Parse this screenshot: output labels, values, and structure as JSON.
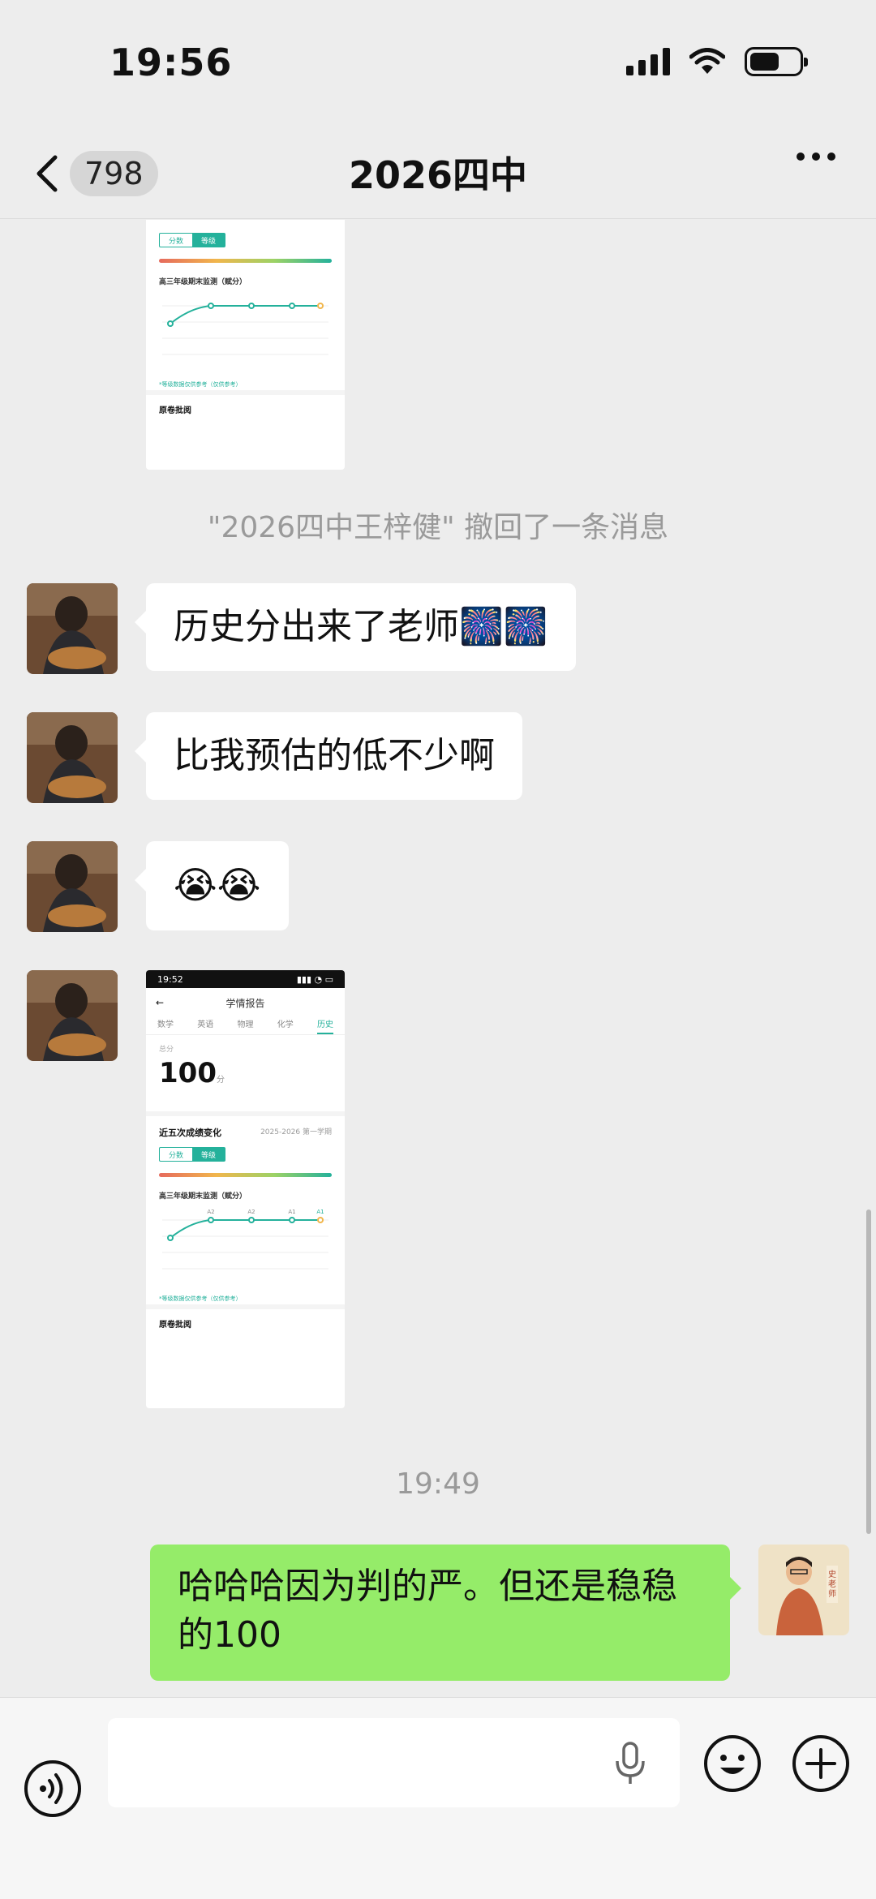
{
  "status_bar": {
    "time": "19:56",
    "signal_icon": "cellular-signal-icon",
    "wifi_icon": "wifi-icon",
    "battery_icon": "battery-icon",
    "battery_level": 0.6
  },
  "nav": {
    "unread_count": "798",
    "title": "2026四中",
    "back_icon": "chevron-left-icon",
    "more_icon": "more-dots-icon"
  },
  "chat": {
    "recall_notice": "\"2026四中王梓健\" 撤回了一条消息",
    "messages": [
      {
        "text": "历史分出来了老师🎆🎆"
      },
      {
        "text": "比我预估的低不少啊"
      },
      {
        "text": "😭😭"
      }
    ],
    "time_separator": "19:49",
    "my_message": "哈哈哈因为判的严。但还是稳稳的100",
    "screenshot": {
      "phone_time": "19:52",
      "header_title": "学情报告",
      "subjects": [
        "数学",
        "英语",
        "物理",
        "化学",
        "历史"
      ],
      "score_label": "总分",
      "score": "100",
      "score_unit": "分",
      "trend_title": "近五次成绩变化",
      "trend_filter": "2025-2026 第一学期",
      "toggle": [
        "分数",
        "等级"
      ],
      "exam_title": "高三年级期末监测（赋分）",
      "chart_points": [
        "A2",
        "A2",
        "A1",
        "A1"
      ],
      "chart_note": "*等级数据仅供参考（仅供参考）",
      "paper_section": "原卷批阅"
    }
  },
  "input_bar": {
    "voice_icon": "voice-toggle-icon",
    "mic_icon": "microphone-icon",
    "emoji_icon": "emoji-smile-icon",
    "plus_icon": "plus-circle-icon",
    "input_value": ""
  },
  "colors": {
    "my_bubble": "#95ec69",
    "their_bubble": "#ffffff",
    "background": "#ededed",
    "accent": "#24b19b"
  }
}
